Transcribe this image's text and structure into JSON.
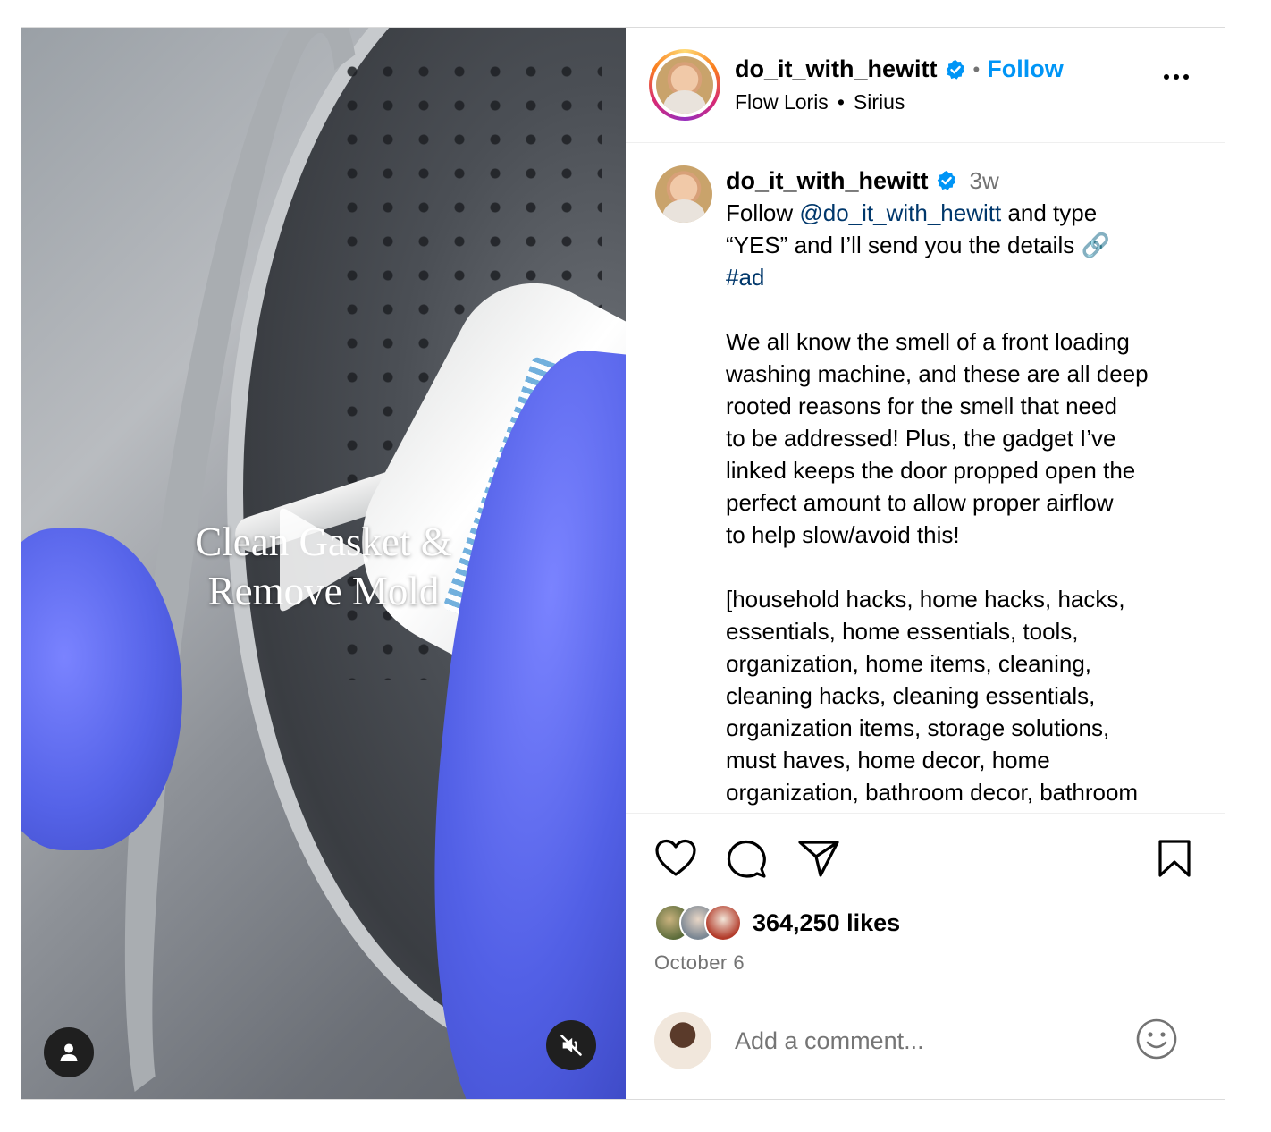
{
  "media": {
    "overlay_line1": "Clean Gasket &",
    "overlay_line2": "Remove Mold",
    "play_icon": "play-icon",
    "user_tag_icon": "person-icon",
    "mute_icon": "speaker-muted-icon"
  },
  "header": {
    "username": "do_it_with_hewitt",
    "verified_icon": "verified-badge-icon",
    "separator": "•",
    "follow_label": "Follow",
    "audio_artist": "Flow Loris",
    "audio_bullet": "•",
    "audio_track": "Sirius",
    "more_icon": "more-options-icon"
  },
  "caption": {
    "username": "do_it_with_hewitt",
    "time_ago": "3w",
    "line1_prefix": "Follow ",
    "mention": "@do_it_with_hewitt",
    "line1_suffix": " and type",
    "line2": "“YES” and I’ll send you the details 🔗",
    "hashtag": "#ad",
    "paragraph2": [
      "We all know the smell of a front loading",
      "washing machine, and these are all deep",
      "rooted reasons for the smell that need",
      "to be addressed! Plus, the gadget I’ve",
      "linked keeps the door propped open the",
      "perfect amount to allow proper airflow",
      "to help slow/avoid this!"
    ],
    "paragraph3": [
      "[household hacks, home hacks, hacks,",
      "essentials, home essentials, tools,",
      "organization, home items, cleaning,",
      "cleaning hacks, cleaning essentials,",
      "organization items, storage solutions,",
      "must haves, home decor, home",
      "organization, bathroom decor, bathroom"
    ]
  },
  "actions": {
    "like_icon": "heart-icon",
    "comment_icon": "comment-icon",
    "share_icon": "send-icon",
    "save_icon": "bookmark-icon"
  },
  "likes": {
    "count_text": "364,250 likes"
  },
  "post_date": "October 6",
  "comment": {
    "placeholder": "Add a comment...",
    "emoji_icon": "emoji-smile-icon"
  },
  "colors": {
    "accent": "#0095f6",
    "link": "#00376b",
    "secondary_text": "#737373",
    "border": "#dbdbdb",
    "glove_blue": "#5563e8"
  }
}
